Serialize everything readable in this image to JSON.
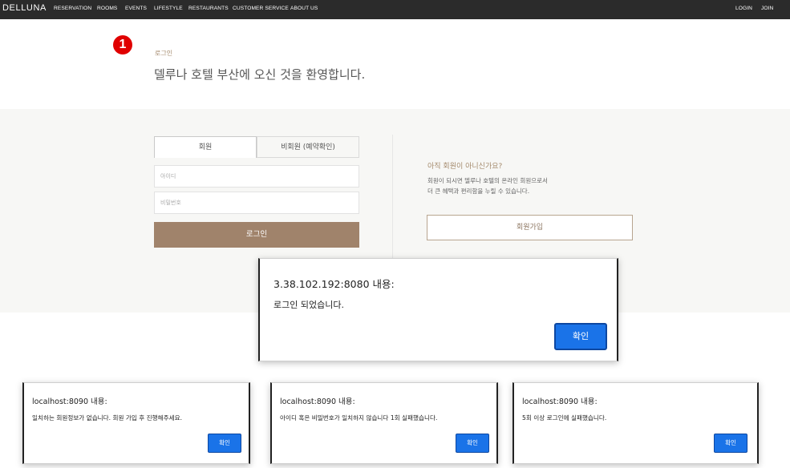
{
  "nav": {
    "brand": "DELLUNA",
    "links": [
      "RESERVATION",
      "ROOMS",
      "EVENTS",
      "LIFESTYLE",
      "RESTAURANTS",
      "CUSTOMER SERVICE",
      "ABOUT US"
    ],
    "login": "LOGIN",
    "join": "JOIN"
  },
  "header": {
    "marker": "1",
    "label": "로그인",
    "welcome": "델루나 호텔 부산에 오신 것을 환영합니다."
  },
  "login_form": {
    "tabs": [
      "회원",
      "비회원 (예약확인)"
    ],
    "id_placeholder": "아이디",
    "pw_placeholder": "비밀번호",
    "login_button": "로그인"
  },
  "signup": {
    "title": "아직 회원이 아니신가요?",
    "desc_line1": "회원이 되시면 델루나 호텔의 온라인 회원으로서",
    "desc_line2": "더 큰 혜택과 편리함을 누릴 수 있습니다.",
    "button": "회원가입"
  },
  "dialog_main": {
    "title": "3.38.102.192:8080 내용:",
    "message": "로그인 되었습니다.",
    "ok": "확인"
  },
  "dialogs_small": [
    {
      "title": "localhost:8090 내용:",
      "message": "일치하는 회원정보가 없습니다. 회원 가입 후 진행해주세요.",
      "ok": "확인"
    },
    {
      "title": "localhost:8090 내용:",
      "message": "아이디 혹은 비밀번호가 일치하지 않습니다 1회 실패했습니다.",
      "ok": "확인"
    },
    {
      "title": "localhost:8090 내용:",
      "message": "5회 이상 로그인에 실패했습니다.",
      "ok": "확인"
    }
  ],
  "colors": {
    "nav_bg": "#2b2b2b",
    "accent_brown": "#a0836b",
    "dialog_button": "#1a73e8",
    "marker_red": "#e00000"
  }
}
